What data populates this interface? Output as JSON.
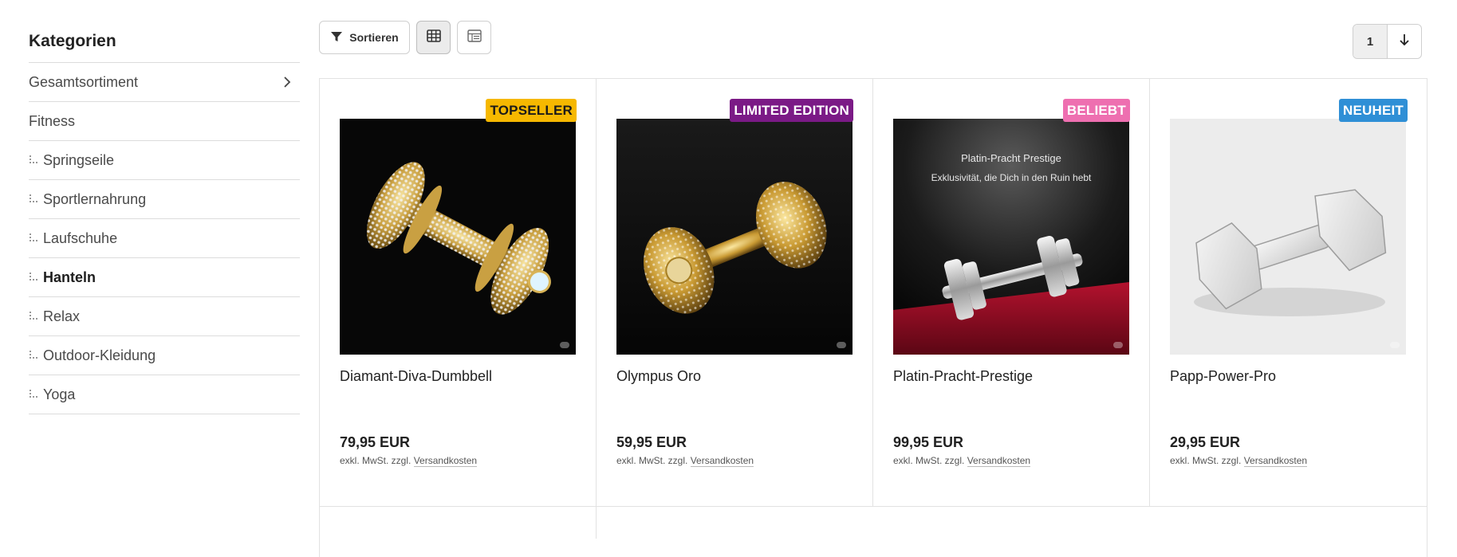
{
  "sidebar": {
    "title": "Kategorien",
    "items": [
      {
        "label": "Gesamtsortiment",
        "type": "root",
        "chevron": true
      },
      {
        "label": "Fitness",
        "type": "parent"
      },
      {
        "label": "Springseile",
        "type": "child"
      },
      {
        "label": "Sportlernahrung",
        "type": "child"
      },
      {
        "label": "Laufschuhe",
        "type": "child"
      },
      {
        "label": "Hanteln",
        "type": "child",
        "active": true
      },
      {
        "label": "Relax",
        "type": "child"
      },
      {
        "label": "Outdoor-Kleidung",
        "type": "child"
      },
      {
        "label": "Yoga",
        "type": "child"
      }
    ]
  },
  "toolbar": {
    "sort_label": "Sortieren",
    "view_grid_icon": "grid-view-icon",
    "view_list_icon": "list-view-icon"
  },
  "pagination": {
    "current_page": "1",
    "icon": "arrow-down-icon"
  },
  "products": [
    {
      "name": "Diamant-Diva-Dumbbell",
      "price": "79,95 EUR",
      "badge": "TOPSELLER",
      "badge_bg": "#f6b800",
      "badge_fg": "#1a1a1a",
      "tax_text": "exkl. MwSt. zzgl.",
      "shipping_link": "Versandkosten",
      "image_style": "dark"
    },
    {
      "name": "Olympus Oro",
      "price": "59,95 EUR",
      "badge": "LIMITED EDITION",
      "badge_bg": "#7b1a86",
      "badge_fg": "#ffffff",
      "tax_text": "exkl. MwSt. zzgl.",
      "shipping_link": "Versandkosten",
      "image_style": "dark"
    },
    {
      "name": "Platin-Pracht-Prestige",
      "price": "99,95 EUR",
      "badge": "BELIEBT",
      "badge_bg": "#ee6fb0",
      "badge_fg": "#ffffff",
      "tax_text": "exkl. MwSt. zzgl.",
      "shipping_link": "Versandkosten",
      "image_style": "dark",
      "image_caption": "Platin-Pracht Prestige",
      "image_subcaption": "Exklusivität, die Dich in den Ruin hebt"
    },
    {
      "name": "Papp-Power-Pro",
      "price": "29,95 EUR",
      "badge": "NEUHEIT",
      "badge_bg": "#2f8fd6",
      "badge_fg": "#ffffff",
      "tax_text": "exkl. MwSt. zzgl.",
      "shipping_link": "Versandkosten",
      "image_style": "light"
    }
  ]
}
